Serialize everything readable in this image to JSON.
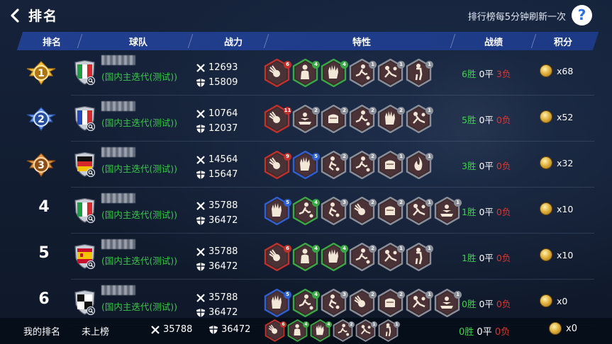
{
  "header": {
    "title": "排名",
    "refresh_note": "排行榜每5分钟刷新一次",
    "help_label": "?"
  },
  "columns": [
    "排名",
    "球队",
    "战力",
    "特性",
    "战绩",
    "积分"
  ],
  "rows": [
    {
      "rank": "1",
      "flag": "italy",
      "server": "(国内主迭代(测试))",
      "attack": "12693",
      "defense": "15809",
      "traits": [
        {
          "icon": "ball",
          "lvl": "6",
          "tone": "red"
        },
        {
          "icon": "player",
          "lvl": "4",
          "tone": "green"
        },
        {
          "icon": "glove",
          "lvl": "4",
          "tone": "green"
        },
        {
          "icon": "kick",
          "lvl": "1",
          "tone": "gray"
        },
        {
          "icon": "tackle",
          "lvl": "1",
          "tone": "gray"
        },
        {
          "icon": "stand",
          "lvl": "1",
          "tone": "gray"
        }
      ],
      "record": {
        "win": "6胜",
        "draw": "0平",
        "loss": "3负"
      },
      "score": "x68"
    },
    {
      "rank": "2",
      "flag": "france",
      "server": "(国内主迭代(测试))",
      "attack": "10764",
      "defense": "12037",
      "traits": [
        {
          "icon": "ball",
          "lvl": "11",
          "tone": "red"
        },
        {
          "icon": "save",
          "lvl": "2",
          "tone": "gray"
        },
        {
          "icon": "fist",
          "lvl": "2",
          "tone": "gray"
        },
        {
          "icon": "kick",
          "lvl": "2",
          "tone": "gray"
        },
        {
          "icon": "glove",
          "lvl": "2",
          "tone": "gray"
        },
        {
          "icon": "tackle",
          "lvl": "1",
          "tone": "gray"
        }
      ],
      "record": {
        "win": "5胜",
        "draw": "0平",
        "loss": "0负"
      },
      "score": "x52"
    },
    {
      "rank": "3",
      "flag": "germany",
      "server": "(国内主迭代(测试))",
      "attack": "14564",
      "defense": "15647",
      "traits": [
        {
          "icon": "ball",
          "lvl": "9",
          "tone": "red"
        },
        {
          "icon": "glove",
          "lvl": "5",
          "tone": "blue"
        },
        {
          "icon": "dribble",
          "lvl": "2",
          "tone": "gray"
        },
        {
          "icon": "kick",
          "lvl": "2",
          "tone": "gray"
        },
        {
          "icon": "fist",
          "lvl": "1",
          "tone": "gray"
        },
        {
          "icon": "fire",
          "lvl": "1",
          "tone": "gray"
        }
      ],
      "record": {
        "win": "3胜",
        "draw": "0平",
        "loss": "0负"
      },
      "score": "x32"
    },
    {
      "rank": "4",
      "flag": "italy",
      "server": "(国内主迭代(测试))",
      "attack": "35788",
      "defense": "36472",
      "traits": [
        {
          "icon": "glove",
          "lvl": "5",
          "tone": "blue"
        },
        {
          "icon": "kick",
          "lvl": "4",
          "tone": "green"
        },
        {
          "icon": "dribble",
          "lvl": "3",
          "tone": "gray"
        },
        {
          "icon": "ball",
          "lvl": "2",
          "tone": "gray"
        },
        {
          "icon": "fist",
          "lvl": "2",
          "tone": "gray"
        },
        {
          "icon": "tackle",
          "lvl": "1",
          "tone": "gray"
        },
        {
          "icon": "save",
          "lvl": "1",
          "tone": "gray"
        }
      ],
      "record": {
        "win": "1胜",
        "draw": "0平",
        "loss": "0负"
      },
      "score": "x10"
    },
    {
      "rank": "5",
      "flag": "spain",
      "server": "(国内主迭代(测试))",
      "attack": "35788",
      "defense": "36472",
      "traits": [
        {
          "icon": "ball",
          "lvl": "6",
          "tone": "red"
        },
        {
          "icon": "player",
          "lvl": "4",
          "tone": "green"
        },
        {
          "icon": "glove",
          "lvl": "4",
          "tone": "green"
        },
        {
          "icon": "kick",
          "lvl": "2",
          "tone": "gray"
        },
        {
          "icon": "tackle",
          "lvl": "1",
          "tone": "gray"
        },
        {
          "icon": "stand",
          "lvl": "1",
          "tone": "gray"
        }
      ],
      "record": {
        "win": "1胜",
        "draw": "0平",
        "loss": "0负"
      },
      "score": "x10"
    },
    {
      "rank": "6",
      "flag": "checker",
      "server": "(国内主迭代(测试))",
      "attack": "35788",
      "defense": "36472",
      "traits": [
        {
          "icon": "glove",
          "lvl": "5",
          "tone": "blue"
        },
        {
          "icon": "kick",
          "lvl": "4",
          "tone": "green"
        },
        {
          "icon": "dribble",
          "lvl": "3",
          "tone": "gray"
        },
        {
          "icon": "ball",
          "lvl": "2",
          "tone": "gray"
        },
        {
          "icon": "fist",
          "lvl": "2",
          "tone": "gray"
        },
        {
          "icon": "tackle",
          "lvl": "1",
          "tone": "gray"
        },
        {
          "icon": "save",
          "lvl": "1",
          "tone": "gray"
        }
      ],
      "record": {
        "win": "0胜",
        "draw": "0平",
        "loss": "0负"
      },
      "score": "x0"
    }
  ],
  "footer": {
    "my_rank_label": "我的排名",
    "my_rank_value": "未上榜",
    "attack": "35788",
    "defense": "36472",
    "traits": [
      {
        "icon": "ball",
        "lvl": "6",
        "tone": "red"
      },
      {
        "icon": "player",
        "lvl": "4",
        "tone": "green"
      },
      {
        "icon": "glove",
        "lvl": "4",
        "tone": "green"
      },
      {
        "icon": "kick",
        "lvl": "2",
        "tone": "gray"
      },
      {
        "icon": "tackle",
        "lvl": "1",
        "tone": "gray"
      },
      {
        "icon": "stand",
        "lvl": "1",
        "tone": "gray"
      }
    ],
    "record": {
      "win": "0胜",
      "draw": "0平",
      "loss": "0负"
    },
    "score": "x0"
  },
  "colors": {
    "win": "#41d24f",
    "loss": "#e0352f",
    "server": "#3bc84a",
    "header_bar": "#213f8f",
    "trait_red": "#c0312b",
    "trait_green": "#3aa844",
    "trait_blue": "#2f5fd0",
    "trait_gray": "#8a8f99"
  }
}
